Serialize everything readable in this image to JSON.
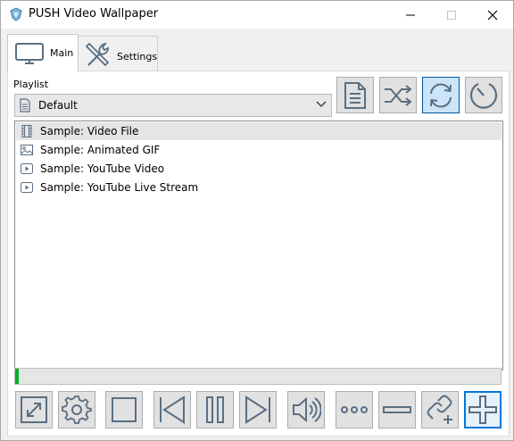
{
  "window": {
    "title": "PUSH Video Wallpaper"
  },
  "tabs": [
    {
      "label": "Main",
      "icon": "monitor-icon",
      "active": true
    },
    {
      "label": "Settings",
      "icon": "tools-icon",
      "active": false
    }
  ],
  "playlist": {
    "label": "Playlist",
    "selected": "Default",
    "items": [
      {
        "label": "Sample: Video File",
        "icon": "film-icon",
        "selected": true
      },
      {
        "label": "Sample: Animated GIF",
        "icon": "image-icon",
        "selected": false
      },
      {
        "label": "Sample: YouTube Video",
        "icon": "play-icon",
        "selected": false
      },
      {
        "label": "Sample: YouTube Live Stream",
        "icon": "play-icon",
        "selected": false
      }
    ]
  },
  "playback_progress": 0.008,
  "top_buttons": [
    "document-icon",
    "shuffle-icon",
    "loop-icon",
    "timer-icon"
  ],
  "bottom_buttons": [
    "expand-icon",
    "gear-icon",
    "stop-icon",
    "previous-icon",
    "pause-icon",
    "next-icon",
    "volume-icon",
    "more-icon",
    "remove-icon",
    "add-url-icon",
    "add-icon"
  ],
  "colors": {
    "progress": "#06b025",
    "accent": "#0078d7",
    "icon": "#5a6f82"
  }
}
